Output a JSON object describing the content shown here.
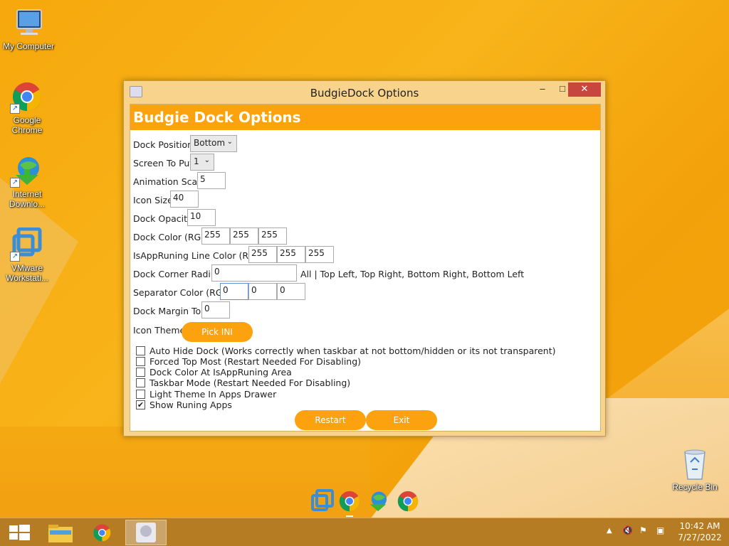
{
  "desktop": {
    "icons": [
      {
        "label": "My Computer",
        "icon": "computer-icon"
      },
      {
        "label": "Google Chrome",
        "icon": "chrome-icon"
      },
      {
        "label": "Internet Downlo...",
        "icon": "internet-download-manager-icon"
      },
      {
        "label": "VMware Workstati...",
        "icon": "vmware-icon"
      },
      {
        "label": "Recycle Bin",
        "icon": "recycle-bin-icon"
      }
    ]
  },
  "window": {
    "title": "BudgieDock Options",
    "controls": {
      "minimize": "–",
      "maximize": "□",
      "close": "✕"
    },
    "banner": "Budgie Dock Options",
    "fields": {
      "dock_position": {
        "label": "Dock Position",
        "value": "Bottom"
      },
      "screen_to_put": {
        "label": "Screen To Put",
        "value": "1"
      },
      "animation_scale": {
        "label": "Animation Scale",
        "value": "5"
      },
      "icon_size": {
        "label": "Icon Size",
        "value": "40"
      },
      "dock_opacity": {
        "label": "Dock Opacity",
        "value": "10"
      },
      "dock_color": {
        "label": "Dock Color (RGB)",
        "r": "255",
        "g": "255",
        "b": "255"
      },
      "line_color": {
        "label": "IsAppRuning Line Color (RGB)",
        "r": "255",
        "g": "255",
        "b": "255"
      },
      "corner_radius": {
        "label": "Dock Corner Radius",
        "value": "0",
        "hint": "All | Top Left, Top Right, Bottom Right, Bottom Left"
      },
      "separator_color": {
        "label": "Separator Color (RGB)",
        "r": "0",
        "g": "0",
        "b": "0"
      },
      "margin_top": {
        "label": "Dock Margin Top",
        "value": "0"
      },
      "icon_theme": {
        "label": "Icon Theme",
        "button": "Pick INI"
      }
    },
    "checkboxes": [
      {
        "label": "Auto Hide Dock (Works correctly when taskbar at not bottom/hidden or its not transparent)",
        "checked": false
      },
      {
        "label": "Forced Top Most (Restart Needed For Disabling)",
        "checked": false
      },
      {
        "label": "Dock Color At IsAppRuning Area",
        "checked": false
      },
      {
        "label": "Taskbar Mode (Restart Needed For Disabling)",
        "checked": false
      },
      {
        "label": "Light Theme In Apps Drawer",
        "checked": false
      },
      {
        "label": "Show Runing Apps",
        "checked": true
      }
    ],
    "buttons": {
      "restart": "Restart",
      "exit": "Exit"
    }
  },
  "dock": {
    "items": [
      "vmware-icon",
      "chrome-icon",
      "internet-download-manager-icon",
      "chrome-icon"
    ]
  },
  "taskbar": {
    "items": [
      "start-icon",
      "file-explorer-icon",
      "chrome-icon",
      "budgiedock-icon"
    ],
    "time": "10:42 AM",
    "date": "7/27/2022"
  },
  "colors": {
    "accent": "#fca20f",
    "close": "#c7473f"
  }
}
